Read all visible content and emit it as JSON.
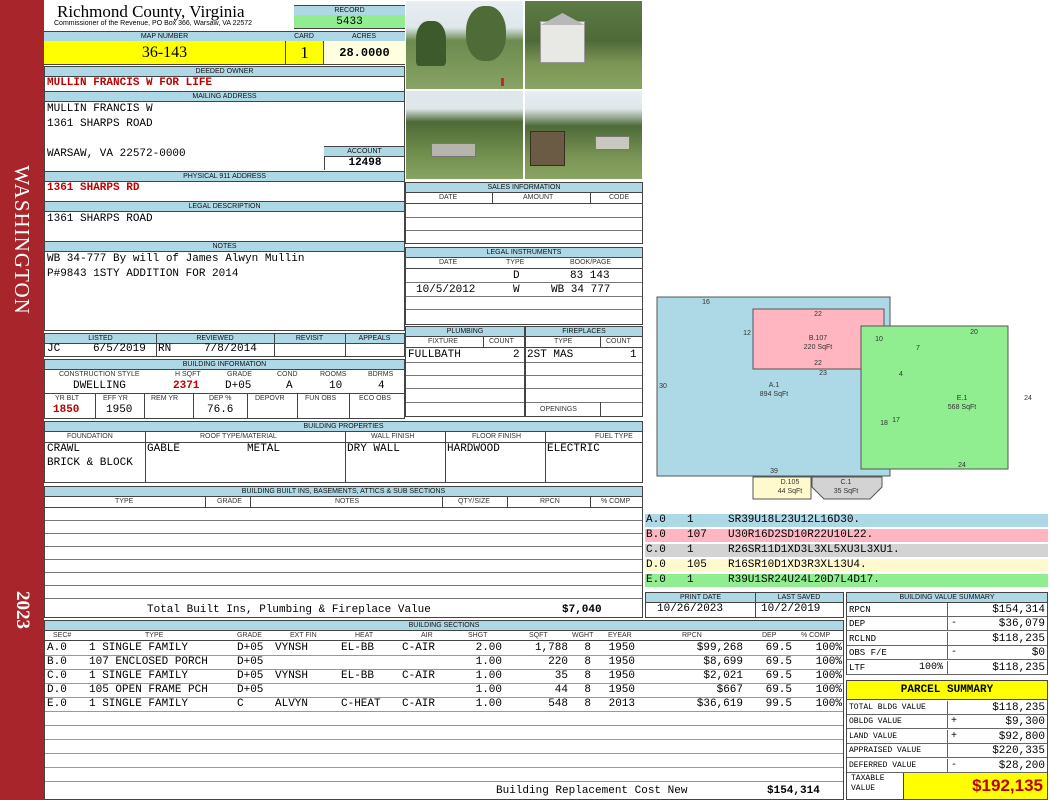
{
  "header": {
    "county": "Richmond County, Virginia",
    "commissioner": "Commissioner of the Revenue, PO Box 366, Warsaw, VA 22572",
    "record_label": "RECORD",
    "record": "5433",
    "map_label": "MAP NUMBER",
    "map_number": "36-143",
    "card_label": "CARD",
    "card": "1",
    "acres_label": "ACRES",
    "acres": "28.0000"
  },
  "sidebar": {
    "district": "WASHINGTON",
    "year": "2023"
  },
  "owner": {
    "deeded_label": "DEEDED OWNER",
    "deeded_owner": "MULLIN FRANCIS W FOR LIFE",
    "mailing_label": "MAILING ADDRESS",
    "mail_line1": "MULLIN FRANCIS W",
    "mail_line2": "1361 SHARPS ROAD",
    "mail_line3": "WARSAW, VA 22572-0000",
    "account_label": "ACCOUNT",
    "account": "12498",
    "physical_label": "PHYSICAL 911 ADDRESS",
    "physical": "1361 SHARPS RD",
    "legal_label": "LEGAL DESCRIPTION",
    "legal": "1361 SHARPS ROAD",
    "notes_label": "NOTES",
    "note1": "WB 34-777 By will of James Alwyn Mullin",
    "note2": "P#9843 1STY ADDITION FOR 2014"
  },
  "sales": {
    "title": "SALES INFORMATION",
    "col_date": "DATE",
    "col_amount": "AMOUNT",
    "col_code": "CODE"
  },
  "legal_instruments": {
    "title": "LEGAL INSTRUMENTS",
    "col_date": "DATE",
    "col_type": "TYPE",
    "col_book": "BOOK/PAGE",
    "rows": [
      {
        "date": "",
        "type": "D",
        "book": "83 143"
      },
      {
        "date": "10/5/2012",
        "type": "W",
        "book": "WB 34 777"
      }
    ]
  },
  "listing": {
    "listed_label": "LISTED",
    "reviewed_label": "REVIEWED",
    "revisit_label": "REVISIT",
    "appeals_label": "APPEALS",
    "listed_by": "JC",
    "listed_date": "6/5/2019",
    "reviewed_by": "RN",
    "reviewed_date": "7/8/2014"
  },
  "building_info": {
    "title": "BUILDING INFORMATION",
    "h_style": "CONSTRUCTION STYLE",
    "h_sqft": "H SQFT",
    "h_grade": "GRADE",
    "h_cond": "COND",
    "h_rooms": "ROOMS",
    "h_bdrms": "BDRMS",
    "style": "DWELLING",
    "sqft": "2371",
    "grade": "D+05",
    "cond": "A",
    "rooms": "10",
    "bdrms": "4",
    "h_yrblt": "YR BLT",
    "h_effyr": "EFF YR",
    "h_remyr": "REM YR",
    "h_dep": "DEP %",
    "h_depovr": "DEPOVR",
    "h_funobs": "FUN OBS",
    "h_ecoobs": "ECO OBS",
    "yrblt": "1850",
    "effyr": "1950",
    "dep": "76.6"
  },
  "plumbing": {
    "title": "PLUMBING",
    "col_fixture": "FIXTURE",
    "col_count": "COUNT",
    "fixture": "FULLBATH",
    "count": "2"
  },
  "fireplaces": {
    "title": "FIREPLACES",
    "col_type": "TYPE",
    "col_count": "COUNT",
    "type": "2ST MAS",
    "count": "1",
    "openings_label": "OPENINGS"
  },
  "properties": {
    "title": "BUILDING PROPERTIES",
    "h_foundation": "FOUNDATION",
    "h_roof": "ROOF TYPE/MATERIAL",
    "h_wall": "WALL FINISH",
    "h_floor": "FLOOR FINISH",
    "h_fuel": "FUEL TYPE",
    "foundation1": "CRAWL",
    "foundation2": "BRICK & BLOCK",
    "roof_type": "GABLE",
    "roof_material": "METAL",
    "wall": "DRY WALL",
    "floor": "HARDWOOD",
    "fuel": "ELECTRIC"
  },
  "builtins": {
    "title": "BUILDING BUILT INS, BASEMENTS, ATTICS & SUB SECTIONS",
    "h_type": "TYPE",
    "h_grade": "GRADE",
    "h_notes": "NOTES",
    "h_qty": "QTY/SIZE",
    "h_rpcn": "RPCN",
    "h_comp": "% COMP",
    "total_label": "Total Built Ins, Plumbing & Fireplace Value",
    "total": "$7,040"
  },
  "dates": {
    "print_label": "PRINT DATE",
    "print_date": "10/26/2023",
    "saved_label": "LAST SAVED",
    "saved_date": "10/2/2019"
  },
  "sections": {
    "title": "BUILDING SECTIONS",
    "headers": [
      "SEC#",
      "TYPE",
      "GRADE",
      "EXT FIN",
      "HEAT",
      "AIR",
      "SHGT",
      "SQFT",
      "WGHT",
      "EYEAR",
      "RPCN",
      "DEP",
      "% COMP"
    ],
    "rows": [
      [
        "A.0",
        "1 SINGLE FAMILY",
        "D+05",
        "VYNSH",
        "EL-BB",
        "C-AIR",
        "2.00",
        "1,788",
        "8",
        "1950",
        "$99,268",
        "69.5",
        "100%"
      ],
      [
        "B.0",
        "107 ENCLOSED PORCH",
        "D+05",
        "",
        "",
        "",
        "1.00",
        "220",
        "8",
        "1950",
        "$8,699",
        "69.5",
        "100%"
      ],
      [
        "C.0",
        "1 SINGLE FAMILY",
        "D+05",
        "VYNSH",
        "EL-BB",
        "C-AIR",
        "1.00",
        "35",
        "8",
        "1950",
        "$2,021",
        "69.5",
        "100%"
      ],
      [
        "D.0",
        "105 OPEN FRAME PCH",
        "D+05",
        "",
        "",
        "",
        "1.00",
        "44",
        "8",
        "1950",
        "$667",
        "69.5",
        "100%"
      ],
      [
        "E.0",
        "1 SINGLE FAMILY",
        "C",
        "ALVYN",
        "C-HEAT",
        "C-AIR",
        "1.00",
        "548",
        "8",
        "2013",
        "$36,619",
        "99.5",
        "100%"
      ]
    ],
    "brcn_label": "Building Replacement Cost New",
    "brcn": "$154,314"
  },
  "sketch": {
    "labels": {
      "a": "A.1",
      "a_area": "894 SqFt",
      "b": "B.107",
      "b_area": "220 SqFt",
      "e": "E.1",
      "e_area": "568 SqFt",
      "d": "D.105",
      "d_area": "44 SqFt",
      "c": "C.1",
      "c_area": "35 SqFt"
    },
    "dims": [
      "16",
      "22",
      "12",
      "10",
      "22",
      "23",
      "30",
      "18",
      "17",
      "4",
      "7",
      "20",
      "24",
      "24",
      "39"
    ],
    "colors": {
      "a": "#add8e6",
      "b": "#ffb6c1",
      "c": "#d3d3d3",
      "d": "#fffacd",
      "e": "#90ee90"
    },
    "segments": [
      {
        "id": "A.0",
        "n": "1",
        "desc": "SR39U18L23U12L16D30.",
        "color": "#add8e6"
      },
      {
        "id": "B.0",
        "n": "107",
        "desc": "U30R16D2SD10R22U10L22.",
        "color": "#ffb6c1"
      },
      {
        "id": "C.0",
        "n": "1",
        "desc": "R26SR11D1XD3L3XL5XU3L3XU1.",
        "color": "#d3d3d3"
      },
      {
        "id": "D.0",
        "n": "105",
        "desc": "R16SR10D1XD3R3XL13U4.",
        "color": "#fffacd"
      },
      {
        "id": "E.0",
        "n": "1",
        "desc": "R39U1SR24U24L20D7L4D17.",
        "color": "#90ee90"
      }
    ]
  },
  "bvs": {
    "title": "BUILDING VALUE SUMMARY",
    "rows": [
      {
        "label": "RPCN",
        "sign": "",
        "value": "$154,314"
      },
      {
        "label": "DEP",
        "sign": "-",
        "value": "$36,079"
      },
      {
        "label": "RCLND",
        "sign": "",
        "value": "$118,235"
      },
      {
        "label": "OBS F/E",
        "sign": "-",
        "value": "$0"
      },
      {
        "label": "LTF",
        "sign": "100%",
        "value": "$118,235"
      }
    ]
  },
  "parcel": {
    "title": "PARCEL SUMMARY",
    "rows": [
      {
        "label": "TOTAL BLDG VALUE",
        "sign": "",
        "value": "$118,235"
      },
      {
        "label": "OBLDG VALUE",
        "sign": "+",
        "value": "$9,300"
      },
      {
        "label": "LAND VALUE",
        "sign": "+",
        "value": "$92,800"
      },
      {
        "label": "APPRAISED VALUE",
        "sign": "",
        "value": "$220,335"
      },
      {
        "label": "DEFERRED VALUE",
        "sign": "-",
        "value": "$28,200"
      }
    ],
    "taxable_label": "TAXABLE VALUE",
    "taxable": "$192,135"
  }
}
